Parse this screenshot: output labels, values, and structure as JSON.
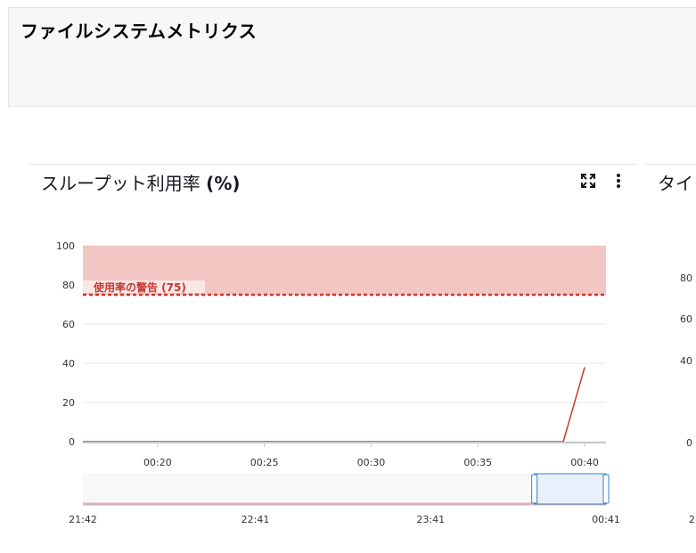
{
  "page": {
    "title": "ファイルシステムメトリクス"
  },
  "panel": {
    "title_text": "スループット利用率 ",
    "title_unit": "(%)",
    "expand_icon": "expand-icon",
    "menu_icon": "more-vertical-icon"
  },
  "panel2": {
    "title_partial": "タイ",
    "y_ticks": [
      "80",
      "60",
      "40",
      "0"
    ],
    "x_partial": "2"
  },
  "colors": {
    "threshold": "#c7372f",
    "threshold_band": "#f2c6c3",
    "line": "#c7372f",
    "navigator_selection": "#e9f0fc",
    "navigator_border": "#3b82c4"
  },
  "chart_data": {
    "type": "line",
    "title": "スループット利用率 (%)",
    "ylim": [
      0,
      100
    ],
    "y_ticks": [
      "0",
      "20",
      "40",
      "60",
      "80",
      "100"
    ],
    "x_ticks": [
      "00:20",
      "00:25",
      "00:30",
      "00:35",
      "00:40"
    ],
    "xlim": [
      "00:16:30",
      "00:41"
    ],
    "grid": true,
    "series": [
      {
        "values": [
          {
            "x": "00:16:30",
            "y": 0
          },
          {
            "x": "00:39",
            "y": 0
          },
          {
            "x": "00:40",
            "y": 38
          }
        ]
      }
    ],
    "threshold": {
      "label": "使用率の警告 (75)",
      "value": 75
    },
    "navigator": {
      "x_ticks": [
        "21:42",
        "22:41",
        "23:41",
        "00:41"
      ],
      "selection": [
        "00:16:30",
        "00:41"
      ]
    }
  }
}
